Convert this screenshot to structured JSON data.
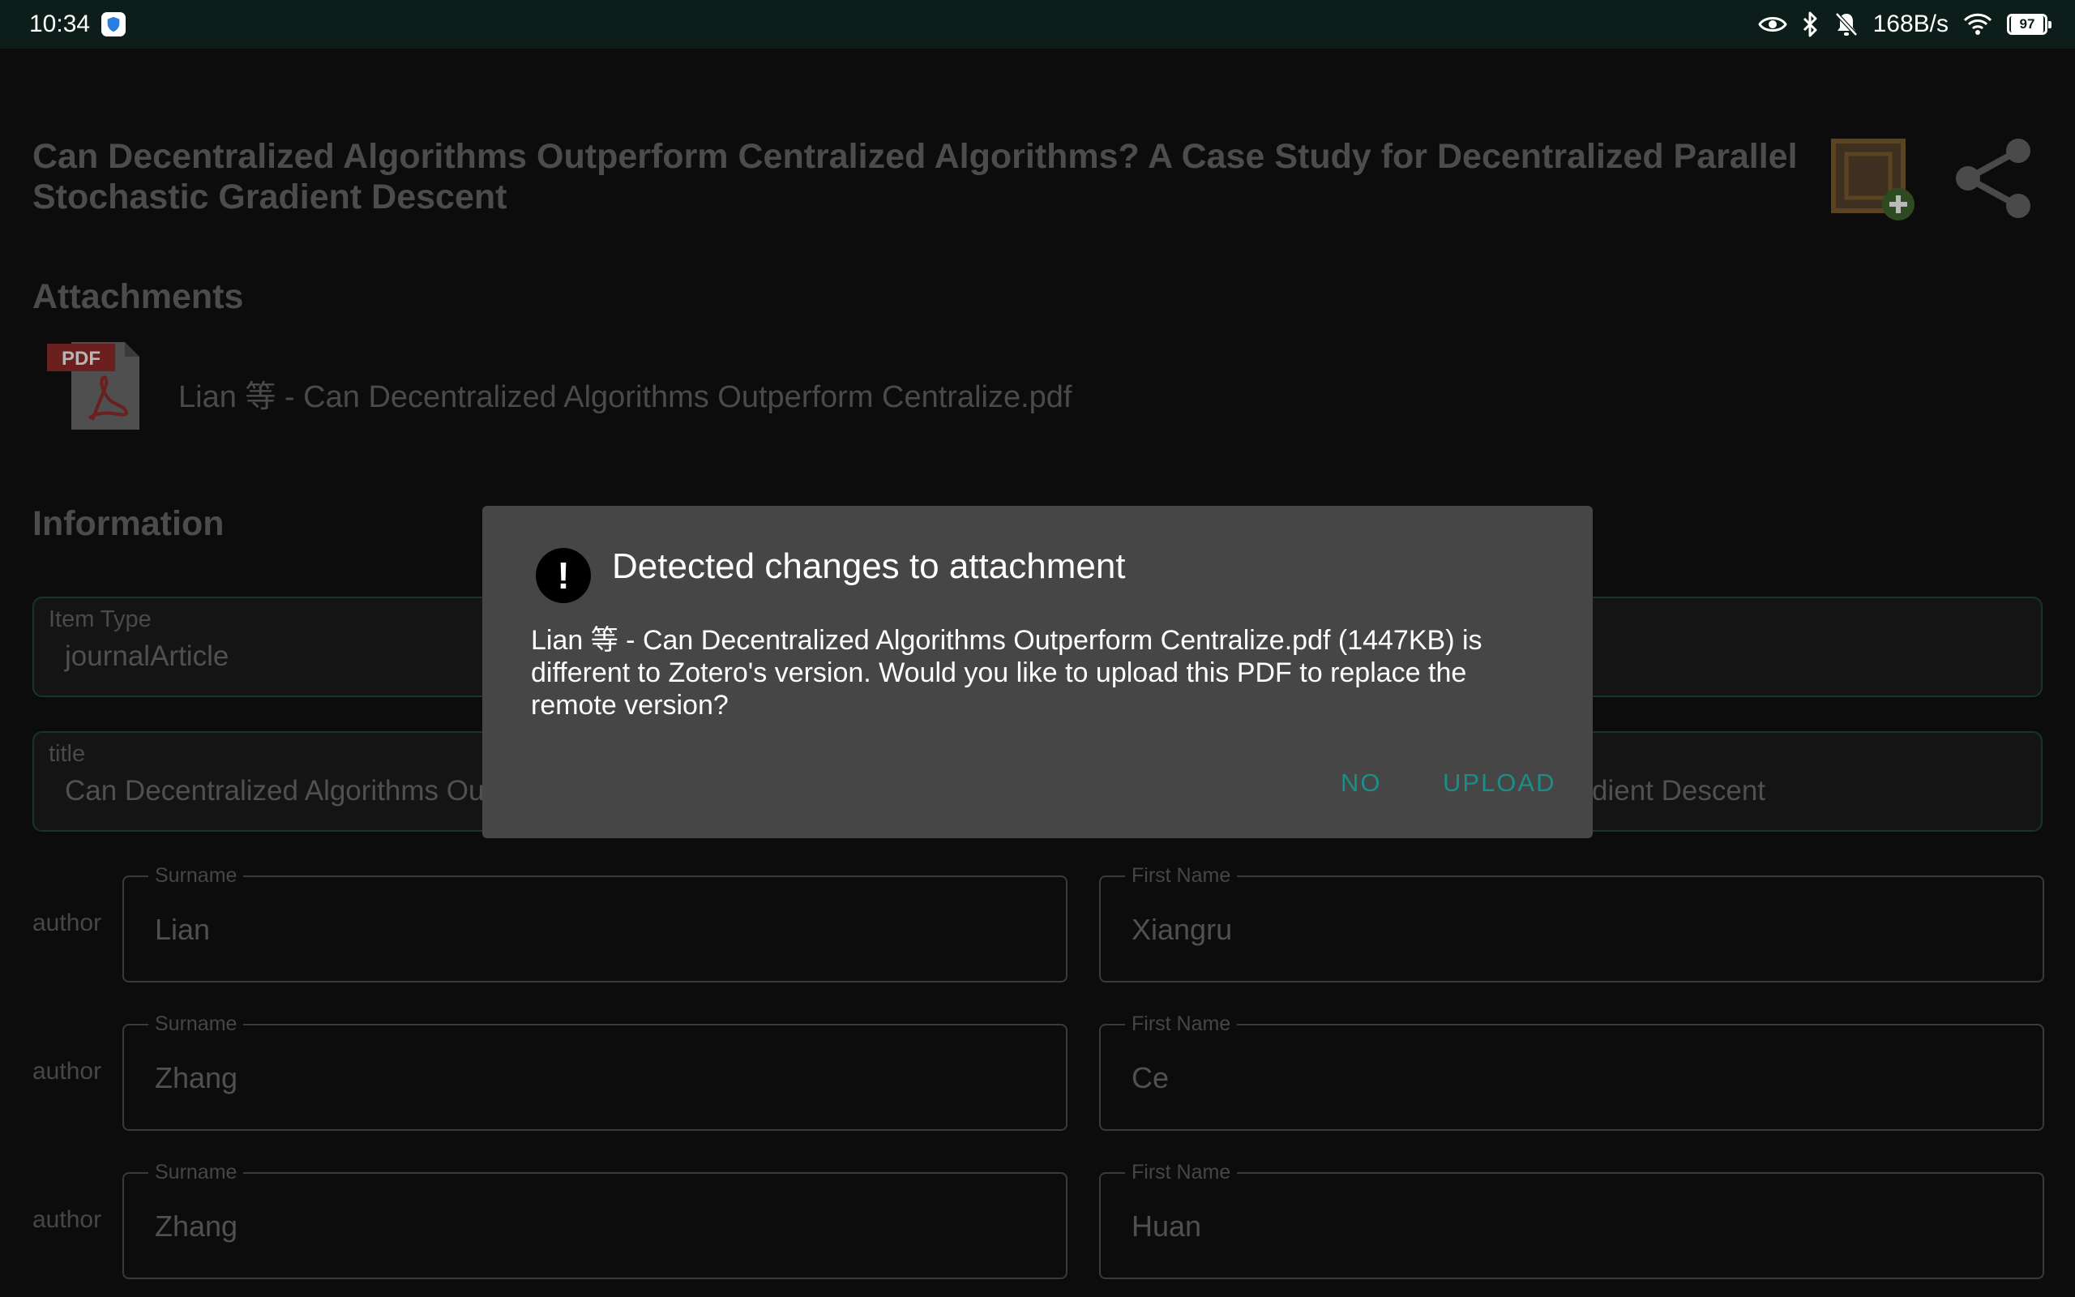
{
  "status_bar": {
    "time": "10:34",
    "net_speed": "168B/s",
    "battery_level": "97"
  },
  "item": {
    "title": "Can Decentralized Algorithms Outperform Centralized Algorithms? A Case Study for Decentralized Parallel Stochastic Gradient Descent"
  },
  "attachments": {
    "heading": "Attachments",
    "file_name": "Lian 等 - Can Decentralized Algorithms Outperform Centralize.pdf",
    "pdf_badge": "PDF"
  },
  "information": {
    "heading": "Information",
    "item_type": {
      "label": "Item Type",
      "value": "journalArticle"
    },
    "title_field": {
      "label": "title",
      "value_start": "Can Decentralized Algorithms Ou",
      "value_end": "dient Descent"
    },
    "authors": [
      {
        "role": "author",
        "surname_label": "Surname",
        "surname": "Lian",
        "first_name_label": "First Name",
        "first_name": "Xiangru"
      },
      {
        "role": "author",
        "surname_label": "Surname",
        "surname": "Zhang",
        "first_name_label": "First Name",
        "first_name": "Ce"
      },
      {
        "role": "author",
        "surname_label": "Surname",
        "surname": "Zhang",
        "first_name_label": "First Name",
        "first_name": "Huan"
      }
    ]
  },
  "dialog": {
    "title": "Detected changes to attachment",
    "message": "Lian 等 - Can Decentralized Algorithms Outperform Centralize.pdf (1447KB) is different to Zotero's version. Would you like to upload this PDF to replace the remote version?",
    "no_label": "NO",
    "upload_label": "UPLOAD"
  },
  "colors": {
    "status_bar_bg": "#0d1d1a",
    "dialog_bg": "#464646",
    "accent": "#1b8f87",
    "field_border": "#17352f"
  }
}
